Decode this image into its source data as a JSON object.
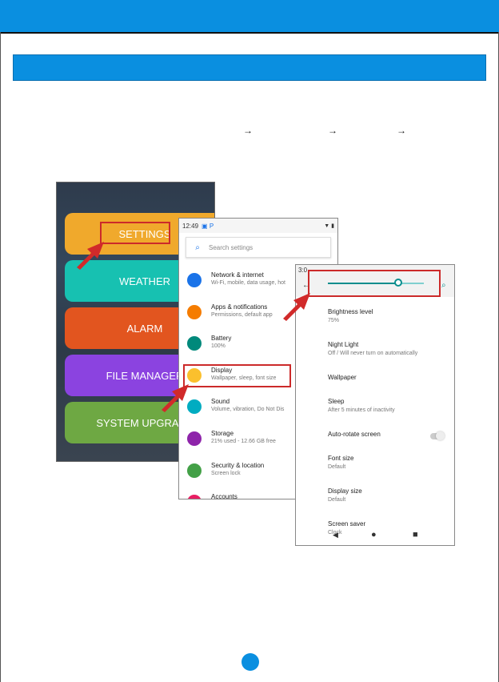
{
  "launcher": {
    "tiles": [
      "SETTINGS",
      "WEATHER",
      "ALARM",
      "FILE MANAGER",
      "SYSTEM UPGRADE"
    ]
  },
  "settings_screen": {
    "time": "12:49",
    "search_placeholder": "Search settings",
    "items": [
      {
        "title": "Network & internet",
        "subtitle": "Wi-Fi, mobile, data usage, hot",
        "color": "#1a73e8"
      },
      {
        "title": "Apps & notifications",
        "subtitle": "Permissions, default app",
        "color": "#f57c00"
      },
      {
        "title": "Battery",
        "subtitle": "100%",
        "color": "#00897b"
      },
      {
        "title": "Display",
        "subtitle": "Wallpaper, sleep, font size",
        "color": "#fbc02d"
      },
      {
        "title": "Sound",
        "subtitle": "Volume, vibration, Do Not Dis",
        "color": "#00acc1"
      },
      {
        "title": "Storage",
        "subtitle": "21% used - 12.66 GB free",
        "color": "#8e24aa"
      },
      {
        "title": "Security & location",
        "subtitle": "Screen lock",
        "color": "#43a047"
      },
      {
        "title": "Accounts",
        "subtitle": "",
        "color": "#e91e63"
      }
    ]
  },
  "display_screen": {
    "time": "3:0",
    "brightness_level": 0.73,
    "items": [
      {
        "title": "Brightness level",
        "subtitle": "75%"
      },
      {
        "title": "Night Light",
        "subtitle": "Off / Will never turn on automatically"
      },
      {
        "title": "Wallpaper",
        "subtitle": ""
      },
      {
        "title": "Sleep",
        "subtitle": "After 5 minutes of inactivity"
      },
      {
        "title": "Auto-rotate screen",
        "subtitle": ""
      },
      {
        "title": "Font size",
        "subtitle": "Default"
      },
      {
        "title": "Display size",
        "subtitle": "Default"
      },
      {
        "title": "Screen saver",
        "subtitle": "Clock"
      }
    ]
  },
  "colors": {
    "accent": "#0a8fe0",
    "highlight": "#cc2a2a"
  }
}
